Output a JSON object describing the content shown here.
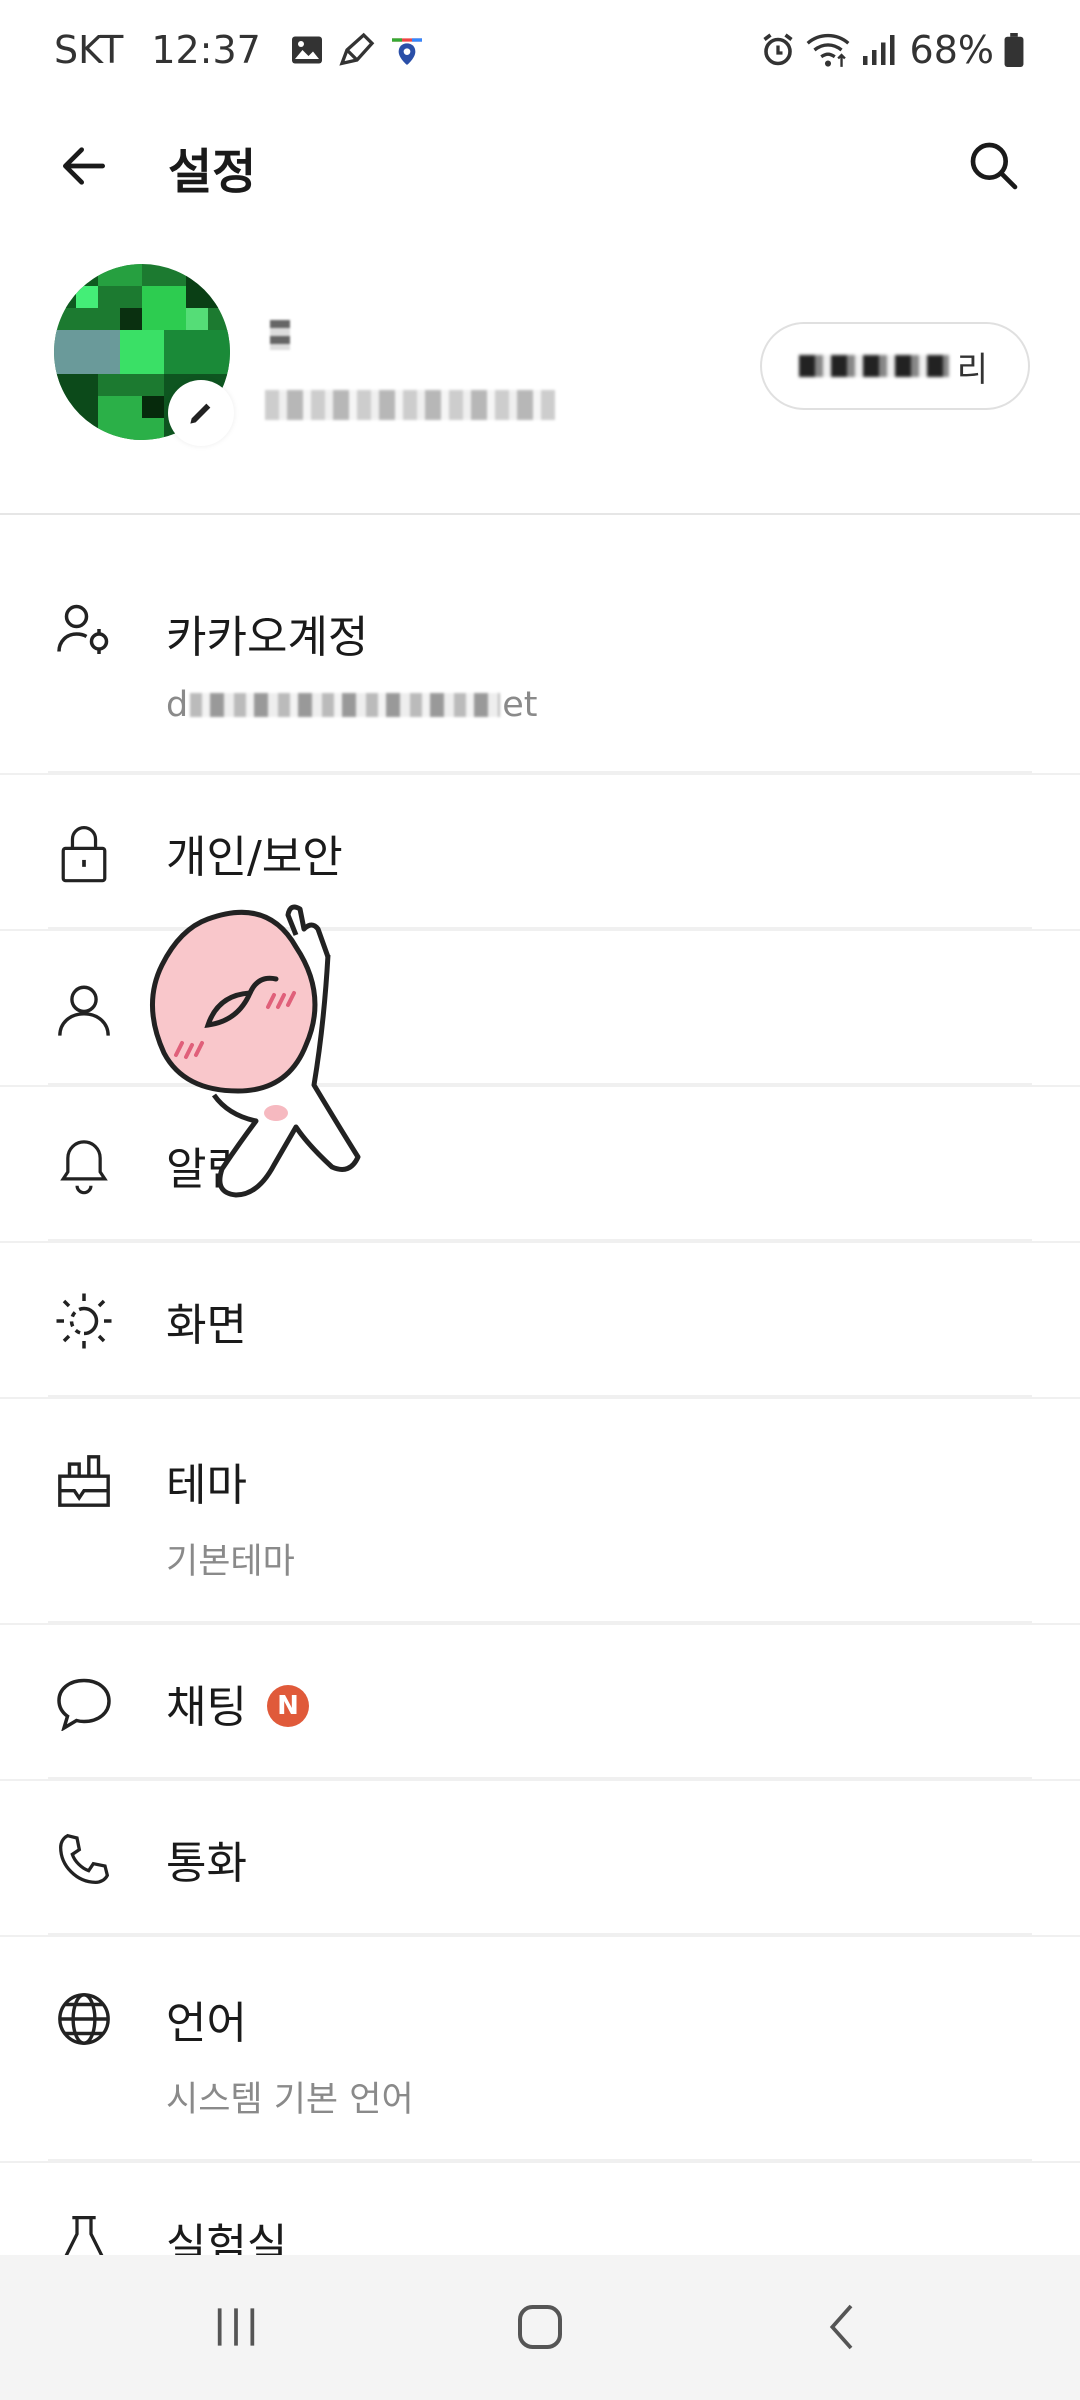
{
  "status_bar": {
    "carrier": "SKT",
    "time": "12:37",
    "battery": "68%",
    "left_icons": [
      "gallery-icon",
      "pen-icon",
      "map-pin-icon"
    ],
    "right_icons": [
      "alarm-icon",
      "wifi-icon",
      "signal-icon",
      "battery-icon"
    ]
  },
  "app_bar": {
    "title": "설정",
    "back_icon": "back-arrow-icon",
    "search_icon": "search-icon"
  },
  "profile": {
    "manage_label_visible": "리"
  },
  "menu": [
    {
      "label": "카카오계정",
      "sub": "d",
      "sub_tail": "et",
      "icon": "account-icon"
    },
    {
      "label": "개인/보안",
      "icon": "lock-icon"
    },
    {
      "label": "",
      "icon": "person-icon"
    },
    {
      "label": "알림",
      "icon": "bell-icon"
    },
    {
      "label": "화면",
      "icon": "brightness-icon"
    },
    {
      "label": "테마",
      "sub": "기본테마",
      "icon": "brush-icon"
    },
    {
      "label": "채팅",
      "badge": "N",
      "icon": "chat-bubble-icon"
    },
    {
      "label": "통화",
      "icon": "phone-icon"
    },
    {
      "label": "언어",
      "sub": "시스템 기본 언어",
      "icon": "globe-icon"
    },
    {
      "label": "실험실",
      "icon": "flask-icon"
    }
  ],
  "colors": {
    "badge": "#e05a3a",
    "text": "#1a1a1a",
    "subtext": "#8a8a8a",
    "nav_bg": "#f4f4f4"
  },
  "nav_bar": {
    "recents_icon": "recents-icon",
    "home_icon": "home-icon",
    "back_icon": "nav-back-icon"
  }
}
